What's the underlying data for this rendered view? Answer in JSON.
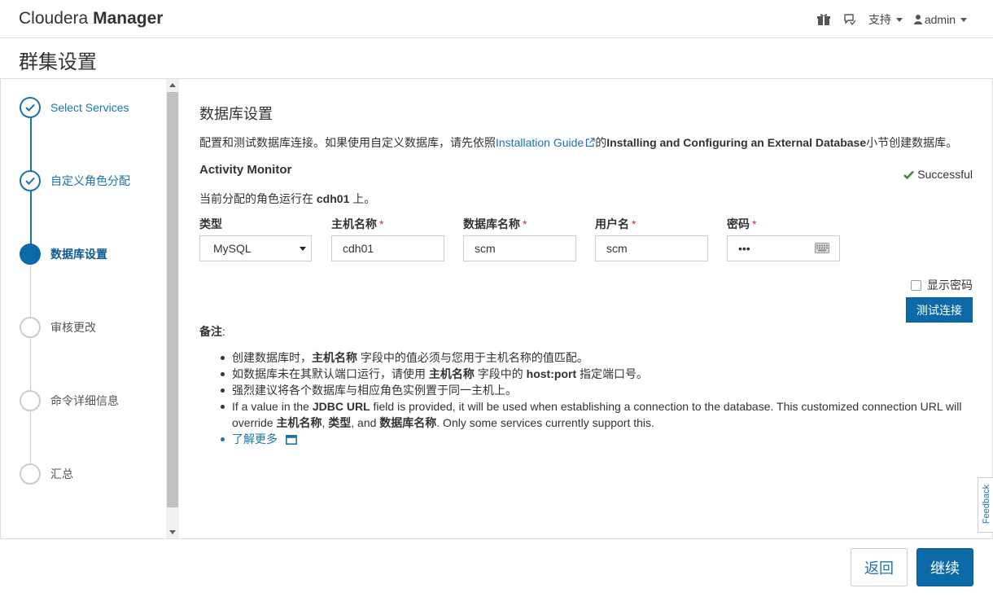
{
  "header": {
    "brand_light": "Cloudera",
    "brand_bold": "Manager",
    "support_label": "支持",
    "user_label": "admin"
  },
  "page": {
    "title": "群集设置"
  },
  "wizard": {
    "steps": [
      {
        "label": "Select Services",
        "state": "done"
      },
      {
        "label": "自定义角色分配",
        "state": "done"
      },
      {
        "label": "数据库设置",
        "state": "current"
      },
      {
        "label": "审核更改",
        "state": "pending"
      },
      {
        "label": "命令详细信息",
        "state": "pending"
      },
      {
        "label": "汇总",
        "state": "pending"
      }
    ]
  },
  "main": {
    "section_title": "数据库设置",
    "intro_prefix": "配置和测试数据库连接。如果使用自定义数据库，请先依照",
    "intro_link": "Installation Guide",
    "intro_mid": "的",
    "intro_bold": "Installing and Configuring an External Database",
    "intro_suffix": "小节创建数据库。",
    "service_title": "Activity Monitor",
    "status": "Successful",
    "running_prefix": "当前分配的角色运行在 ",
    "running_host": "cdh01",
    "running_suffix": " 上。",
    "fields": {
      "type_label": "类型",
      "type_value": "MySQL",
      "host_label": "主机名称",
      "host_value": "cdh01",
      "dbname_label": "数据库名称",
      "dbname_value": "scm",
      "user_label": "用户名",
      "user_value": "scm",
      "password_label": "密码",
      "password_value": "•••",
      "required_mark": "*"
    },
    "show_password_label": "显示密码",
    "test_button": "测试连接",
    "notes_label": "备注",
    "notes_colon": ":",
    "notes": {
      "n1_a": "创建数据库时，",
      "n1_b": "主机名称",
      "n1_c": " 字段中的值必须与您用于主机名称的值匹配。",
      "n2_a": "如数据库未在其默认端口运行，请使用 ",
      "n2_b": "主机名称",
      "n2_c": " 字段中的 ",
      "n2_d": "host:port",
      "n2_e": " 指定端口号。",
      "n3": "强烈建议将各个数据库与相应角色实例置于同一主机上。",
      "n4_a": "If a value in the ",
      "n4_b": "JDBC URL",
      "n4_c": " field is provided, it will be used when establishing a connection to the database. This customized connection URL will override ",
      "n4_d": "主机名称",
      "n4_e": ", ",
      "n4_f": "类型",
      "n4_g": ", and ",
      "n4_h": "数据库名称",
      "n4_i": ". Only some services currently support this.",
      "learn_more": "了解更多"
    }
  },
  "feedback_label": "Feedback",
  "footer": {
    "back_button": "返回",
    "continue_button": "继续"
  },
  "colors": {
    "accent": "#0d6aa8",
    "link": "#1a75a6",
    "success": "#3c8d2f",
    "required": "#c9302c"
  },
  "icons": {
    "gift": "gift-icon",
    "feedback": "chat-icon",
    "check": "check-icon",
    "external": "external-link-icon",
    "keyboard": "keyboard-icon",
    "window": "window-icon"
  }
}
